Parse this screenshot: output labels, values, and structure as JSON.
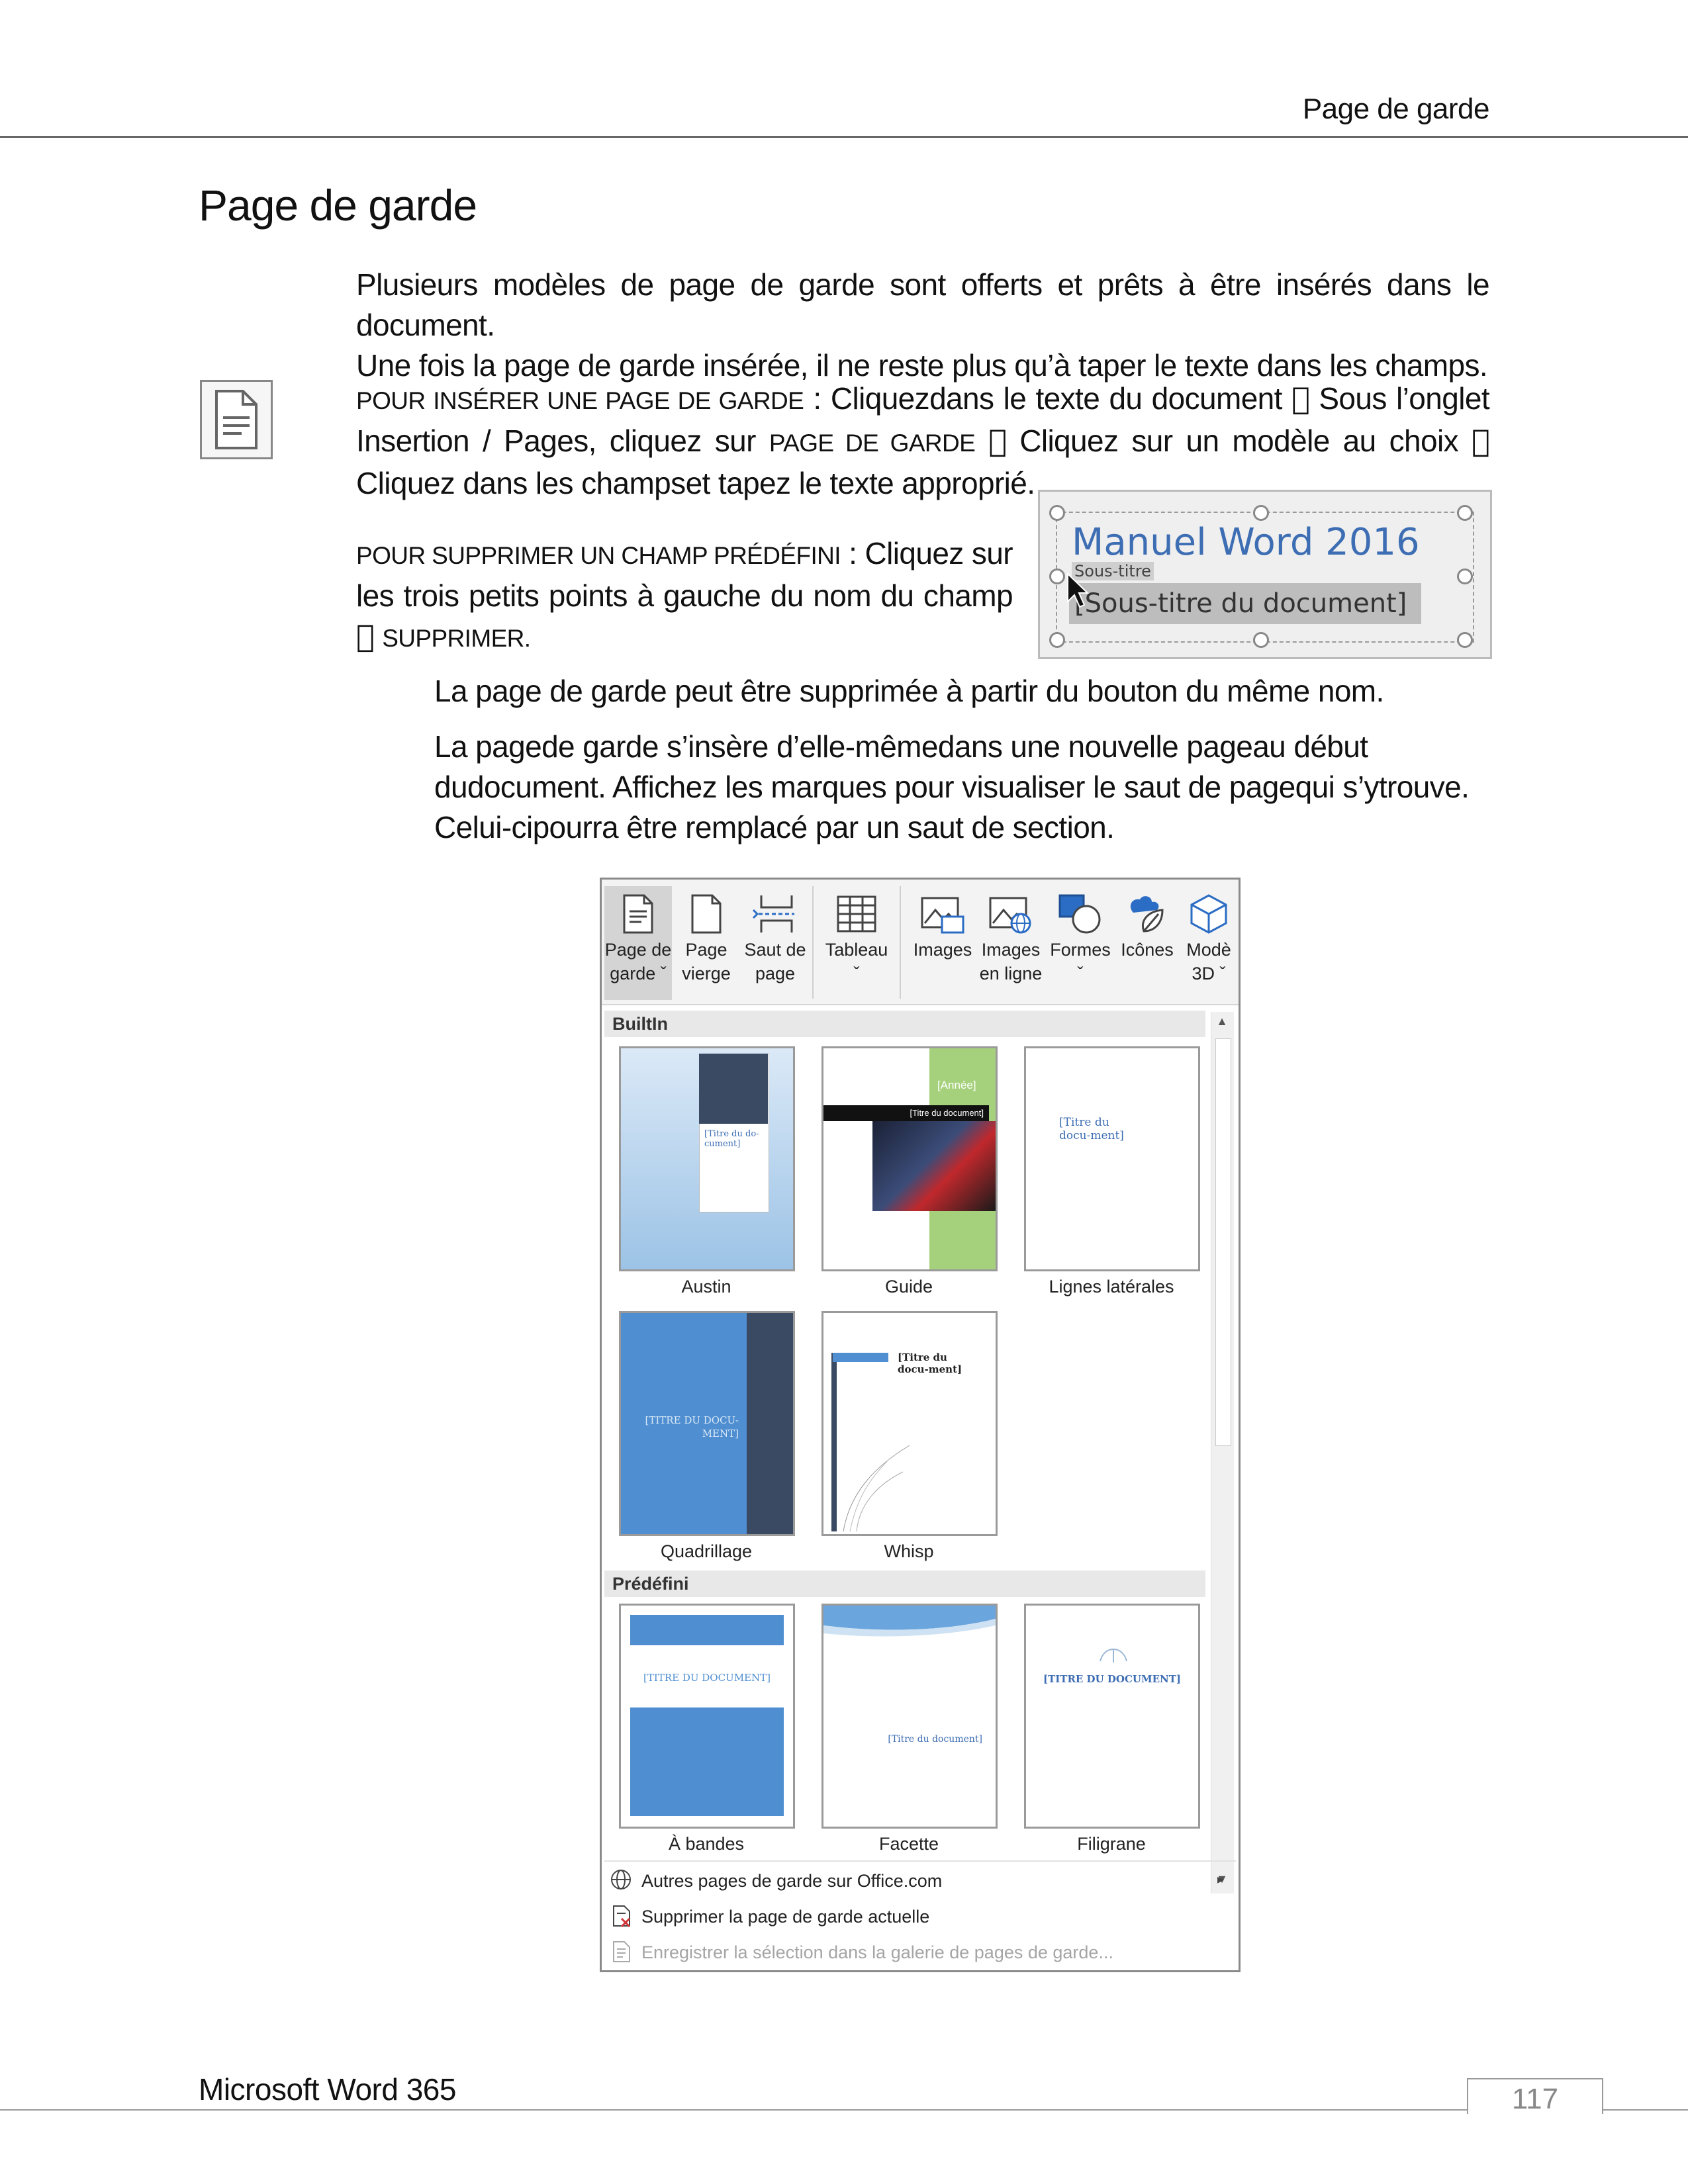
{
  "header": {
    "running_title": "Page de garde"
  },
  "title": "Page de garde",
  "intro": {
    "line1": "Plusieurs modèles de page de garde sont offerts et prêts à être insérés dans le document.",
    "line2": "Une fois la page de garde insérée, il ne reste plus qu’à taper le texte dans les champs."
  },
  "insert_steps": {
    "label": "Pour insérer une page de garde",
    "sep": " : ",
    "text_a": "Cliquezdans le texte du document",
    "text_b": "Sous l’onglet Insertion / Pages, cliquez sur",
    "label_b": "Page de garde",
    "text_c": "Cliquez sur un modèle au choix",
    "text_d": "Cliquez dans les champset tapez le texte approprié.",
    "arrow": ""
  },
  "delete_field": {
    "label": "Pour supprimer un champ prédéfini",
    "sep": " : ",
    "text": "Cliquez sur les trois petits points à gauche du nom du champ",
    "action": "Supprimer."
  },
  "figure1": {
    "title": "Manuel Word 2016",
    "field_label": "Sous-titre",
    "field_value": "[Sous-titre du document]"
  },
  "notes": {
    "n1": "La page de garde peut être supprimée à partir du bouton du même nom.",
    "n2": "La pagede garde s’insère d’elle-mêmedans une nouvelle pageau début dudocument. Affichez les marques pour visualiser le saut de pagequi s’ytrouve. Celui-cipourra être remplacé par un saut de section."
  },
  "ribbon": {
    "buttons": [
      {
        "line1": "Page de",
        "line2": "garde ˇ",
        "icon": "cover-page-icon"
      },
      {
        "line1": "Page",
        "line2": "vierge",
        "icon": "blank-page-icon"
      },
      {
        "line1": "Saut de",
        "line2": "page",
        "icon": "page-break-icon"
      },
      {
        "line1": "Tableau",
        "line2": "ˇ",
        "icon": "table-icon"
      },
      {
        "line1": "Images",
        "line2": "",
        "icon": "pictures-icon"
      },
      {
        "line1": "Images",
        "line2": "en ligne",
        "icon": "online-pictures-icon"
      },
      {
        "line1": "Formes",
        "line2": "ˇ",
        "icon": "shapes-icon"
      },
      {
        "line1": "Icônes",
        "line2": "",
        "icon": "icons-icon"
      },
      {
        "line1": "Modè",
        "line2": "3D ˇ",
        "icon": "3d-models-icon"
      }
    ]
  },
  "gallery": {
    "section_builtin": "BuiltIn",
    "section_predefini": "Prédéfini",
    "items": [
      {
        "name": "Austin",
        "title": "[Titre du do-cument]"
      },
      {
        "name": "Guide",
        "title": "[Titre du document]",
        "year": "[Année]"
      },
      {
        "name": "Lignes latérales",
        "title": "[Titre du docu-ment]"
      },
      {
        "name": "Quadrillage",
        "title": "[TITRE DU DOCU-MENT]"
      },
      {
        "name": "Whisp",
        "title": "[Titre du docu-ment]"
      },
      {
        "name": "À bandes",
        "title": "[TITRE DU DOCUMENT]"
      },
      {
        "name": "Facette",
        "title": "[Titre du document]"
      },
      {
        "name": "Filigrane",
        "title": "[TITRE DU DOCUMENT]"
      }
    ]
  },
  "menu": {
    "more": "Autres pages de garde sur Office.com",
    "remove": "Supprimer la page de garde actuelle",
    "save": "Enregistrer la sélection dans la galerie de pages de garde..."
  },
  "footer": {
    "product": "Microsoft Word 365",
    "page_number": "117"
  }
}
